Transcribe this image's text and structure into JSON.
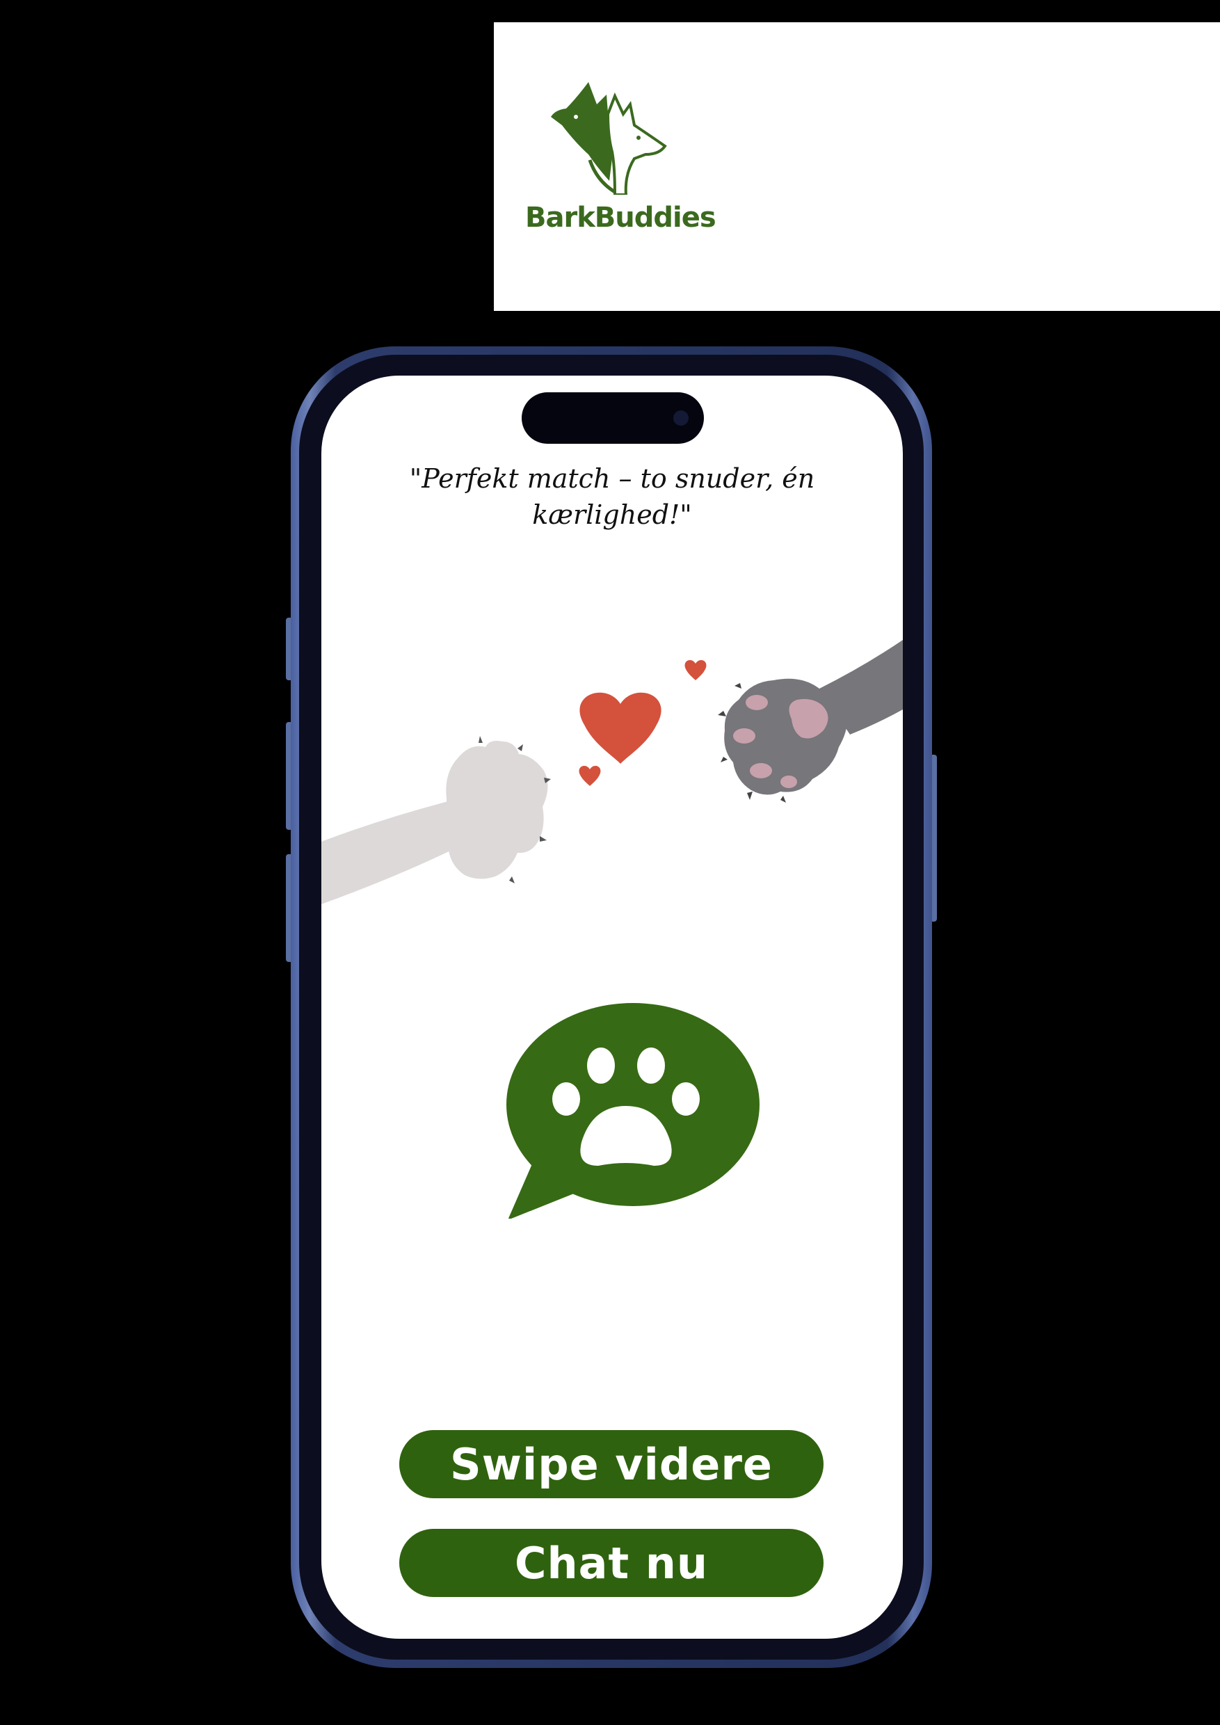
{
  "brand": {
    "name": "BarkBuddies",
    "logo_icon": "two-dogs-logo-icon",
    "color": "#3b6a1e"
  },
  "match_screen": {
    "quote": "\"Perfekt match – to snuder, én kærlighed!\"",
    "illustration": "paws-with-hearts-illustration",
    "chat_icon": "paw-chat-bubble-icon",
    "buttons": {
      "swipe_label": "Swipe videre",
      "chat_label": "Chat nu"
    }
  },
  "colors": {
    "accent_green": "#2f620e",
    "heart_red": "#d4513c",
    "phone_frame": "#3a4c85"
  }
}
